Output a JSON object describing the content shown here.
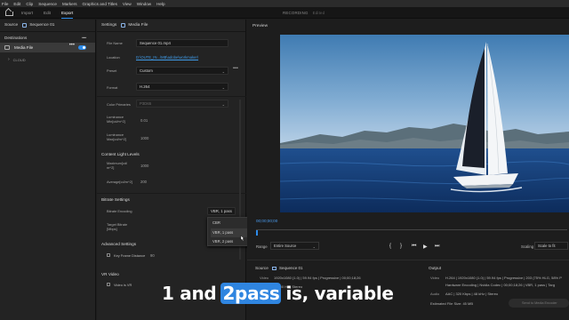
{
  "menu": [
    "File",
    "Edit",
    "Clip",
    "Sequence",
    "Markers",
    "Graphics and Titles",
    "View",
    "Window",
    "Help"
  ],
  "workspace_tabs": [
    "Import",
    "Edit",
    "Export"
  ],
  "active_tab": "Export",
  "status": {
    "recording": "RECORDING",
    "edited": "Edited"
  },
  "source_panel": {
    "title": "Source",
    "sequence": "Sequence 01",
    "destinations_label": "Destinations",
    "destinations_menu": "•••",
    "media_file": "Media File",
    "media_file_menu": "•••",
    "cloud": "CLOUD"
  },
  "settings": {
    "title": "Settings",
    "mode": "Media File",
    "file_name_label": "File Name",
    "file_name": "Sequence 01.mp4",
    "location_label": "Location",
    "location": "D:\\OUTE_IN...\\MB\\adobe\\workmaker\\",
    "preset_label": "Preset",
    "preset": "Custom",
    "preset_menu": "•••",
    "format_label": "Format",
    "format": "H.264",
    "color_primaries_label": "Color Primaries",
    "color_primaries": "P3D65",
    "lum_min_label": "Luminance Min[cd/m^2]",
    "lum_min": "0.01",
    "lum_max_label": "Luminance Max[cd/m^2]",
    "lum_max": "1000",
    "content_light_label": "Content Light Levels",
    "maximum_label": "Maximum[cd/ m^2]",
    "maximum": "1000",
    "average_label": "Average[cd/m^2]",
    "average": "200",
    "bitrate_section": "Bitrate Settings",
    "bitrate_encoding_label": "Bitrate Encoding",
    "bitrate_encoding": "VBR, 1 pass",
    "target_bitrate_label": "Target Bitrate [Mbps]",
    "advanced_section": "Advanced Settings",
    "key_frame_label": "Key Frame Distance",
    "key_frame_value": "90",
    "vr_section": "VR Video",
    "video_vr_label": "Video is VR"
  },
  "dropdown": {
    "options": [
      "CBR",
      "VBR, 1 pass",
      "VBR, 2 pass"
    ],
    "selected": "VBR, 1 pass"
  },
  "preview": {
    "title": "Preview",
    "timecode": "00;00;00;00",
    "range_label": "Range",
    "range": "Entire Source",
    "scaling_label": "Scaling",
    "scaling": "Scale to fit"
  },
  "summary": {
    "source_title": "Source",
    "source_seq": "Sequence 01",
    "video_k": "Video",
    "video_src": "1920x1080 (1.0)  |  59.94 fps  |  Progressive  |  00;00;18;26",
    "audio_k": "Audio",
    "audio_src": "48000 Hz  |  Stereo",
    "output_title": "Output",
    "out_video": "H.264  |  1920x1080 (1.0)  |  59.94 fps  |  Progressive  |  203 (75% HLG, 58% P",
    "out_video2": "Hardware Encoding  |  Nvidia Codec  |  00;00;18;26  |  VBR, 1 pass  |  Targ",
    "out_audio": "AAC  |  320 Kbps  |  48 kHz  |  Stereo",
    "est_size": "Estimated File Size:  45 MB",
    "send_button": "Send to Media Encoder"
  },
  "caption": {
    "part1": "1 and",
    "highlight": "2pass",
    "part2": "is, variable"
  },
  "colors": {
    "accent": "#2d8ceb",
    "link": "#3f9be8",
    "panel": "#232323"
  }
}
